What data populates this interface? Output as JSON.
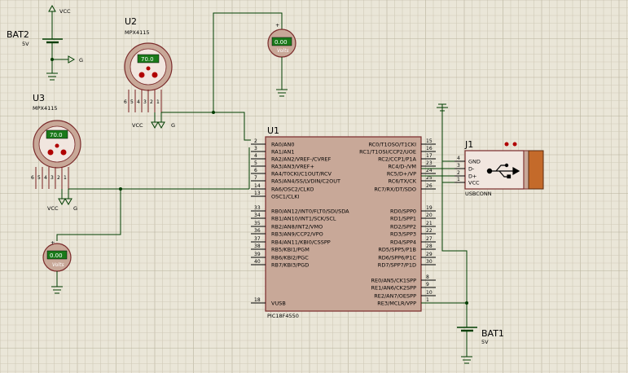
{
  "grid": {
    "minor_color": "#cfcab8",
    "major_color": "#b8b29c",
    "background": "#eae6d8"
  },
  "colors": {
    "body": "#c8a898",
    "body_stroke": "#7a2a2a",
    "wire": "#003d00",
    "lcd": "#1a7a1a",
    "jtag": "#c46a2a"
  },
  "bat2": {
    "ref": "BAT2",
    "value": "5V",
    "vcc": "VCC",
    "g": "G"
  },
  "bat1": {
    "ref": "BAT1",
    "value": "5V"
  },
  "u2": {
    "ref": "U2",
    "part": "MPX4115",
    "display": "70.0",
    "pins": [
      "6",
      "5",
      "4",
      "3",
      "2",
      "1"
    ],
    "vcc": "VCC",
    "g": "G"
  },
  "u3": {
    "ref": "U3",
    "part": "MPX4115",
    "display": "70.0",
    "pins": [
      "6",
      "5",
      "4",
      "3",
      "2",
      "1"
    ],
    "vcc": "VCC",
    "g": "G"
  },
  "volt_top": {
    "display": "0.00",
    "units": "Volts",
    "plus": "+",
    "minus": "-"
  },
  "volt_left": {
    "display": "0.00",
    "units": "Volts",
    "plus": "+",
    "minus": "-"
  },
  "u1": {
    "ref": "U1",
    "part": "PIC18F4550",
    "left_pins": [
      {
        "num": "2",
        "name": "RA0/AN0"
      },
      {
        "num": "3",
        "name": "RA1/AN1"
      },
      {
        "num": "4",
        "name": "RA2/AN2/VREF-/CVREF"
      },
      {
        "num": "5",
        "name": "RA3/AN3/VREF+"
      },
      {
        "num": "6",
        "name": "RA4/T0CKI/C1OUT/RCV"
      },
      {
        "num": "7",
        "name": "RA5/AN4/SS/LVDIN/C2OUT"
      },
      {
        "num": "14",
        "name": "RA6/OSC2/CLKO"
      },
      {
        "num": "13",
        "name": "OSC1/CLKI"
      },
      {
        "num": "33",
        "name": "RB0/AN12/INT0/FLT0/SDI/SDA"
      },
      {
        "num": "34",
        "name": "RB1/AN10/INT1/SCK/SCL"
      },
      {
        "num": "35",
        "name": "RB2/AN8/INT2/VMO"
      },
      {
        "num": "36",
        "name": "RB3/AN9/CCP2/VPO"
      },
      {
        "num": "37",
        "name": "RB4/AN11/KBI0/CSSPP"
      },
      {
        "num": "38",
        "name": "RB5/KBI1/PGM"
      },
      {
        "num": "39",
        "name": "RB6/KBI2/PGC"
      },
      {
        "num": "40",
        "name": "RB7/KBI3/PGD"
      },
      {
        "num": "18",
        "name": "VUSB"
      }
    ],
    "right_pins": [
      {
        "num": "15",
        "name": "RC0/T1OSO/T1CKI"
      },
      {
        "num": "16",
        "name": "RC1/T1OSI/CCP2/UOE"
      },
      {
        "num": "17",
        "name": "RC2/CCP1/P1A"
      },
      {
        "num": "23",
        "name": "RC4/D-/VM"
      },
      {
        "num": "24",
        "name": "RC5/D+/VP"
      },
      {
        "num": "25",
        "name": "RC6/TX/CK"
      },
      {
        "num": "26",
        "name": "RC7/RX/DT/SDO"
      },
      {
        "num": "19",
        "name": "RD0/SPP0"
      },
      {
        "num": "20",
        "name": "RD1/SPP1"
      },
      {
        "num": "21",
        "name": "RD2/SPP2"
      },
      {
        "num": "22",
        "name": "RD3/SPP3"
      },
      {
        "num": "27",
        "name": "RD4/SPP4"
      },
      {
        "num": "28",
        "name": "RD5/SPP5/P1B"
      },
      {
        "num": "29",
        "name": "RD6/SPP6/P1C"
      },
      {
        "num": "30",
        "name": "RD7/SPP7/P1D"
      },
      {
        "num": "8",
        "name": "RE0/AN5/CK1SPP"
      },
      {
        "num": "9",
        "name": "RE1/AN6/CK2SPP"
      },
      {
        "num": "10",
        "name": "RE2/AN7/OESPP"
      },
      {
        "num": "1",
        "name": "RE3/MCLR/VPP"
      }
    ]
  },
  "j1": {
    "ref": "J1",
    "part": "USBCONN",
    "pins": [
      {
        "num": "4",
        "name": "GND"
      },
      {
        "num": "3",
        "name": "D-"
      },
      {
        "num": "2",
        "name": "D+"
      },
      {
        "num": "1",
        "name": "VCC"
      }
    ]
  }
}
